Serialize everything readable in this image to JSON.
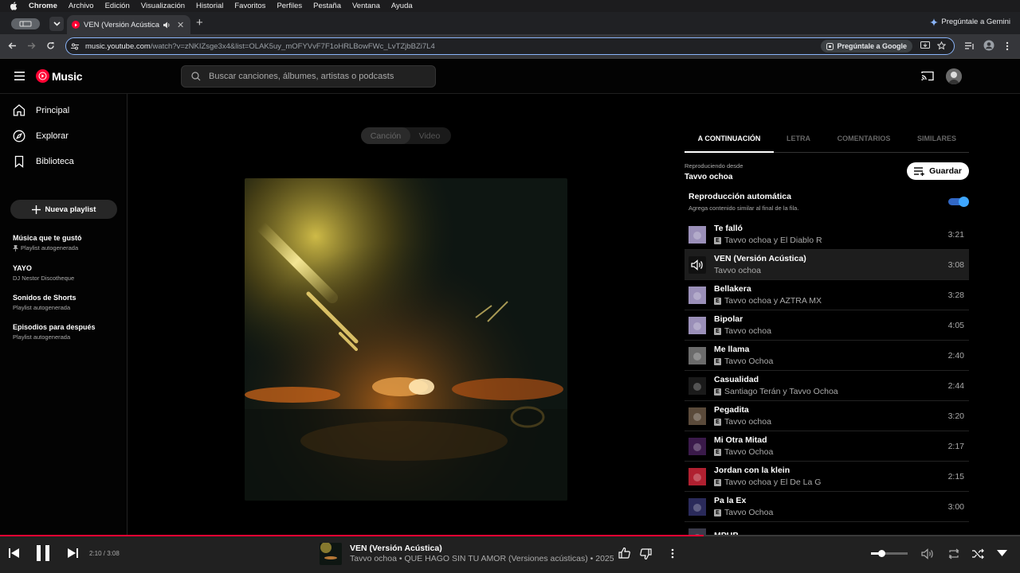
{
  "macos_menu": {
    "items": [
      "Chrome",
      "Archivo",
      "Edición",
      "Visualización",
      "Historial",
      "Favoritos",
      "Perfiles",
      "Pestaña",
      "Ventana",
      "Ayuda"
    ]
  },
  "browser": {
    "tab_title": "VEN (Versión Acústica) | Y",
    "gemini_label": "Pregúntale a Gemini",
    "url_host": "music.youtube.com",
    "url_path": "/watch?v=zNKIZsge3x4&list=OLAK5uy_mOFYVvF7F1oHRLBowFWc_LvTZjbBZi7L4",
    "ask_google_label": "Pregúntale a Google"
  },
  "header": {
    "logo_text": "Music",
    "search_placeholder": "Buscar canciones, álbumes, artistas o podcasts"
  },
  "sidebar": {
    "nav": [
      {
        "label": "Principal",
        "icon": "home-icon"
      },
      {
        "label": "Explorar",
        "icon": "compass-icon"
      },
      {
        "label": "Biblioteca",
        "icon": "library-icon"
      }
    ],
    "new_playlist_label": "Nueva playlist",
    "playlists": [
      {
        "name": "Música que te gustó",
        "subtitle": "Playlist autogenerada",
        "pinned": true
      },
      {
        "name": "YAYO",
        "subtitle": "DJ Nestor Discotheque",
        "pinned": false
      },
      {
        "name": "Sonidos de Shorts",
        "subtitle": "Playlist autogenerada",
        "pinned": false
      },
      {
        "name": "Episodios para después",
        "subtitle": "Playlist autogenerada",
        "pinned": false
      }
    ]
  },
  "main": {
    "toggle_song": "Canción",
    "toggle_video": "Video"
  },
  "panel": {
    "tabs": [
      "A CONTINUACIÓN",
      "LETRA",
      "COMENTARIOS",
      "SIMILARES"
    ],
    "playing_from_label": "Reproduciendo desde",
    "playing_from_value": "Tavvo ochoa",
    "save_label": "Guardar",
    "autoplay_title": "Reproducción automática",
    "autoplay_desc": "Agrega contenido similar al final de la fila.",
    "autoplay_on": true,
    "queue": [
      {
        "title": "Te falló",
        "artist": "Tavvo ochoa y El Diablo R",
        "duration": "3:21",
        "explicit": true,
        "color": "#9a8fb8"
      },
      {
        "title": "VEN (Versión Acústica)",
        "artist": "Tavvo ochoa",
        "duration": "3:08",
        "explicit": false,
        "playing": true,
        "color": "#111111"
      },
      {
        "title": "Bellakera",
        "artist": "Tavvo ochoa y AZTRA MX",
        "duration": "3:28",
        "explicit": true,
        "color": "#9a8fb8"
      },
      {
        "title": "Bipolar",
        "artist": "Tavvo ochoa",
        "duration": "4:05",
        "explicit": true,
        "color": "#9a8fb8"
      },
      {
        "title": "Me llama",
        "artist": "Tavvo Ochoa",
        "duration": "2:40",
        "explicit": true,
        "color": "#6b6b6b"
      },
      {
        "title": "Casualidad",
        "artist": "Santiago Terán y Tavvo Ochoa",
        "duration": "2:44",
        "explicit": true,
        "color": "#1a1a1a"
      },
      {
        "title": "Pegadita",
        "artist": "Tavvo ochoa",
        "duration": "3:20",
        "explicit": true,
        "color": "#5a4a3a"
      },
      {
        "title": "Mi Otra Mitad",
        "artist": "Tavvo Ochoa",
        "duration": "2:17",
        "explicit": true,
        "color": "#3a1a4a"
      },
      {
        "title": "Jordan con la klein",
        "artist": "Tavvo ochoa y El De La G",
        "duration": "2:15",
        "explicit": true,
        "color": "#b02030"
      },
      {
        "title": "Pa la Ex",
        "artist": "Tavvo Ochoa",
        "duration": "3:00",
        "explicit": true,
        "color": "#2a2a5a"
      },
      {
        "title": "MPUB",
        "artist": "",
        "duration": "",
        "explicit": false,
        "color": "#3a3a4a"
      }
    ]
  },
  "player": {
    "time": "2:10 / 3:08",
    "progress_fraction": 0.69,
    "title": "VEN (Versión Acústica)",
    "subtitle": "Tavvo ochoa • QUE HAGO SIN TU AMOR (Versiones acústicas) • 2025",
    "volume_fraction": 0.3
  }
}
